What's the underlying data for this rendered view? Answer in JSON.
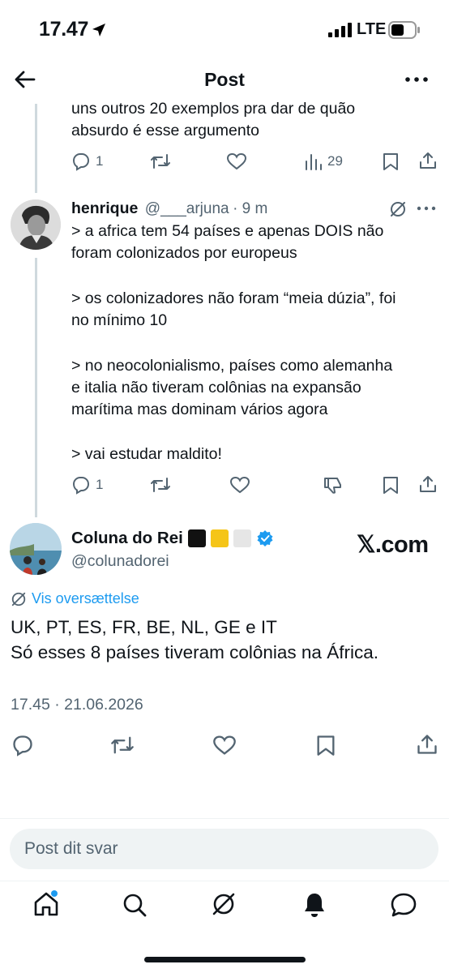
{
  "status_bar": {
    "time": "17.47",
    "network": "LTE"
  },
  "header": {
    "title": "Post"
  },
  "prev_reply": {
    "text_line1": "uns outros 20 exemplos pra dar de quão",
    "text_line2": "absurdo é esse argumento",
    "replies": "1",
    "views": "29"
  },
  "reply_henrique": {
    "name": "henrique",
    "handle": "@___arjuna",
    "time": "· 9 m",
    "lines": [
      "> a africa tem 54 países e apenas DOIS não",
      "foram colonizados por europeus",
      "> os colonizadores não foram “meia dúzia”, foi",
      "no mínimo 10",
      "> no neocolonialismo, países como alemanha",
      "e italia não tiveram colônias na expansão",
      "marítima mas dominam vários agora",
      "> vai estudar maldito!"
    ],
    "replies": "1"
  },
  "main_post": {
    "name": "Coluna do Rei",
    "handle": "@colunadorei",
    "translate_label": "Vis oversættelse",
    "text_line1": "UK, PT, ES, FR, BE, NL, GE e IT",
    "text_line2": "Só esses 8 países tiveram colônias na África.",
    "timestamp": "17.45 · 21.06.2026",
    "watermark": "𝕏.com"
  },
  "reply_bar": {
    "placeholder": "Post dit svar"
  },
  "icons": {
    "back": "arrow-left-icon",
    "more": "more-icon",
    "reply": "reply-icon",
    "retweet": "retweet-icon",
    "like": "heart-icon",
    "views": "views-icon",
    "bookmark": "bookmark-icon",
    "share": "share-icon",
    "grok": "grok-icon",
    "verified": "verified-badge-icon",
    "home": "home-icon",
    "search": "search-icon",
    "notifications": "bell-icon",
    "messages": "messages-icon"
  },
  "colors": {
    "accent": "#1d9bf0",
    "text": "#0f1419",
    "secondary": "#536471",
    "thread_line": "#cfd9de"
  }
}
